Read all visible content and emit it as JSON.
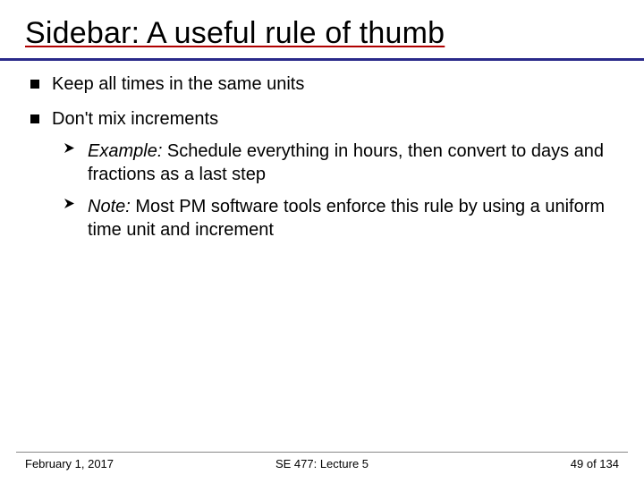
{
  "title": "Sidebar: A useful rule of thumb",
  "bullets": [
    {
      "text": "Keep all times in the same units"
    },
    {
      "text": "Don't mix increments"
    }
  ],
  "subbullets": [
    {
      "lead": "Example:",
      "rest": " Schedule everything in hours, then convert to days and fractions as a last step"
    },
    {
      "lead": "Note:",
      "rest": " Most PM software tools enforce this rule by using a uniform time unit and increment"
    }
  ],
  "footer": {
    "date": "February 1, 2017",
    "course": "SE 477: Lecture 5",
    "page": "49 of 134"
  }
}
